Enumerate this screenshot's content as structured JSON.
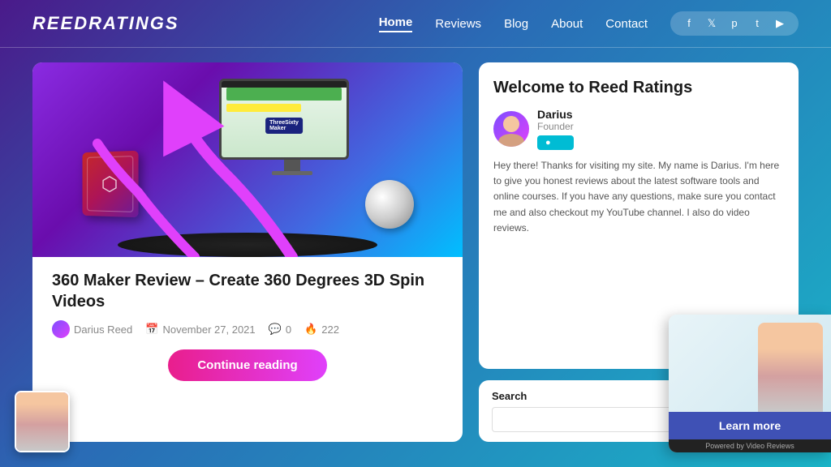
{
  "header": {
    "logo": "ReedRatings",
    "nav": {
      "items": [
        {
          "label": "Home",
          "active": true
        },
        {
          "label": "Reviews",
          "active": false
        },
        {
          "label": "Blog",
          "active": false
        },
        {
          "label": "About",
          "active": false
        },
        {
          "label": "Contact",
          "active": false
        }
      ]
    },
    "social": {
      "icons": [
        "f",
        "t",
        "p",
        "t",
        "yt"
      ]
    }
  },
  "article": {
    "title": "360 Maker Review – Create 360 Degrees 3D Spin Videos",
    "author": "Darius Reed",
    "date": "November 27, 2021",
    "comments": "0",
    "views": "222",
    "continue_btn": "Continue reading",
    "image_label": "ThreeSixty Maker"
  },
  "sidebar": {
    "welcome_title": "Welcome to Reed Ratings",
    "author_name": "Darius",
    "author_role": "Founder",
    "author_link": "●",
    "welcome_text": "Hey there! Thanks for visiting my site. My name is Darius. I'm here to give you honest reviews about the latest software tools and online courses. If you have any questions, make sure you contact me and also checkout my YouTube channel. I also do video reviews.",
    "search_label": "Search",
    "search_placeholder": ""
  },
  "video_widget": {
    "learn_btn": "Learn more",
    "powered_text": "Powered by Video Reviews"
  }
}
